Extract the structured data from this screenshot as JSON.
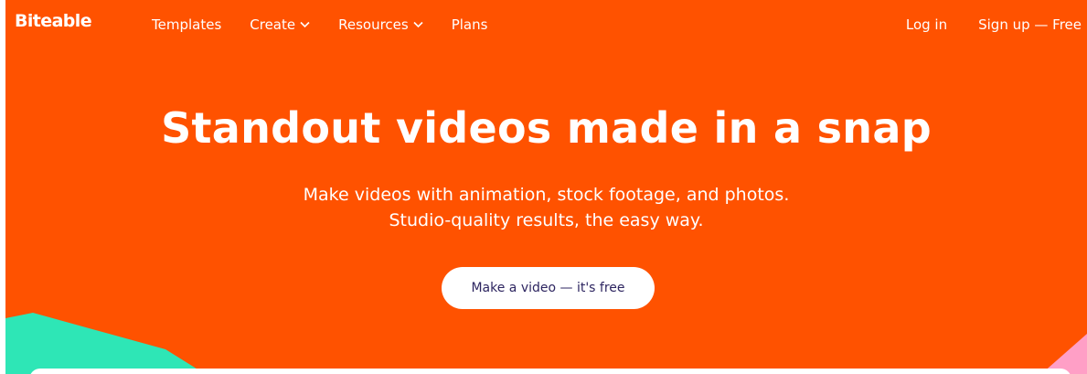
{
  "brand": {
    "name": "Biteable",
    "primary_color": "#ff5200",
    "accent_teal": "#2ee6b6",
    "accent_pink": "#ff9fc6",
    "cta_text_color": "#2d2560"
  },
  "nav": {
    "items": [
      {
        "label": "Templates",
        "dropdown": false
      },
      {
        "label": "Create",
        "dropdown": true
      },
      {
        "label": "Resources",
        "dropdown": true
      },
      {
        "label": "Plans",
        "dropdown": false
      }
    ],
    "login_label": "Log in",
    "signup_label": "Sign up — Free"
  },
  "hero": {
    "headline": "Standout videos made in a snap",
    "subline_1": "Make videos with animation, stock footage, and photos.",
    "subline_2": "Studio-quality results, the easy way.",
    "cta_label": "Make a video — it's free"
  },
  "icons": {
    "dropdown": "chevron-down-icon"
  }
}
